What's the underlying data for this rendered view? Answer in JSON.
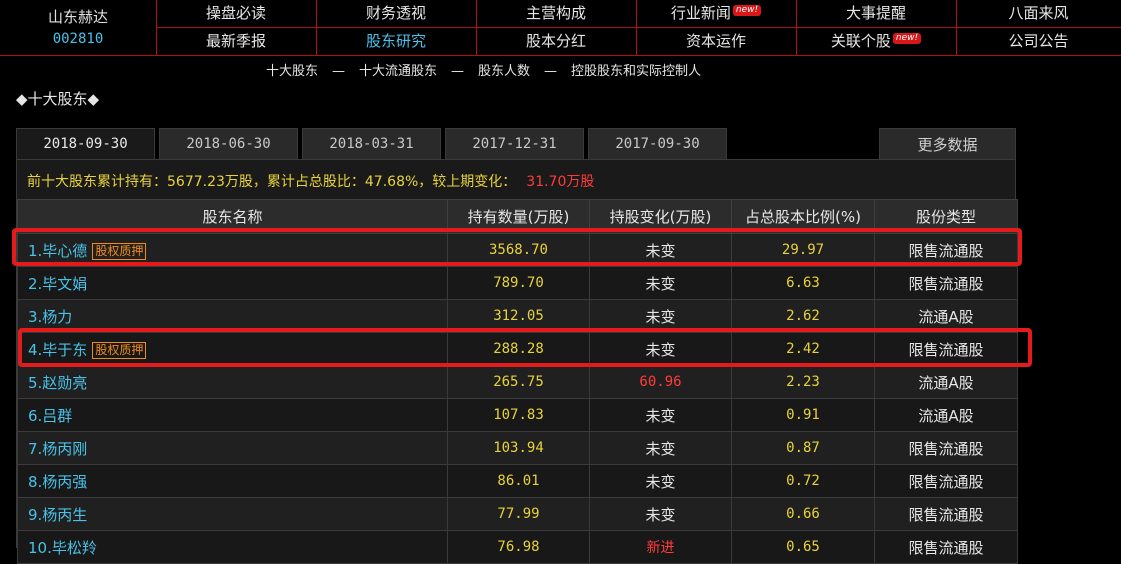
{
  "stock": {
    "name": "山东赫达",
    "code": "002810"
  },
  "nav": {
    "row1": [
      {
        "label": "操盘必读",
        "badge": ""
      },
      {
        "label": "财务透视",
        "badge": ""
      },
      {
        "label": "主营构成",
        "badge": ""
      },
      {
        "label": "行业新闻",
        "badge": "new!"
      },
      {
        "label": "大事提醒",
        "badge": ""
      },
      {
        "label": "八面来风",
        "badge": ""
      }
    ],
    "row2": [
      {
        "label": "最新季报",
        "badge": ""
      },
      {
        "label": "股东研究",
        "badge": "",
        "active": true
      },
      {
        "label": "股本分红",
        "badge": ""
      },
      {
        "label": "资本运作",
        "badge": ""
      },
      {
        "label": "关联个股",
        "badge": "new!"
      },
      {
        "label": "公司公告",
        "badge": ""
      }
    ]
  },
  "subnav": {
    "items": [
      "十大股东",
      "十大流通股东",
      "股东人数",
      "控股股东和实际控制人"
    ],
    "separator": "—"
  },
  "section_title": "◆十大股东◆",
  "tabs": [
    "2018-09-30",
    "2018-06-30",
    "2018-03-31",
    "2017-12-31",
    "2017-09-30"
  ],
  "active_tab": "2018-09-30",
  "more_label": "更多数据",
  "summary": {
    "text": "前十大股东累计持有：5677.23万股，累计占总股比：47.68%，较上期变化：",
    "change": "31.70万股"
  },
  "table": {
    "headers": [
      "股东名称",
      "持有数量(万股)",
      "持股变化(万股)",
      "占总股本比例(%)",
      "股份类型"
    ],
    "rows": [
      {
        "name": "1.毕心德",
        "pledge": "股权质押",
        "qty": "3568.70",
        "change": "未变",
        "ratio": "29.97",
        "type": "限售流通股"
      },
      {
        "name": "2.毕文娟",
        "pledge": "",
        "qty": "789.70",
        "change": "未变",
        "ratio": "6.63",
        "type": "限售流通股"
      },
      {
        "name": "3.杨力",
        "pledge": "",
        "qty": "312.05",
        "change": "未变",
        "ratio": "2.62",
        "type": "流通A股"
      },
      {
        "name": "4.毕于东",
        "pledge": "股权质押",
        "qty": "288.28",
        "change": "未变",
        "ratio": "2.42",
        "type": "限售流通股"
      },
      {
        "name": "5.赵勋亮",
        "pledge": "",
        "qty": "265.75",
        "change": "60.96",
        "ratio": "2.23",
        "type": "流通A股"
      },
      {
        "name": "6.吕群",
        "pledge": "",
        "qty": "107.83",
        "change": "未变",
        "ratio": "0.91",
        "type": "流通A股"
      },
      {
        "name": "7.杨丙刚",
        "pledge": "",
        "qty": "103.94",
        "change": "未变",
        "ratio": "0.87",
        "type": "限售流通股"
      },
      {
        "name": "8.杨丙强",
        "pledge": "",
        "qty": "86.01",
        "change": "未变",
        "ratio": "0.72",
        "type": "限售流通股"
      },
      {
        "name": "9.杨丙生",
        "pledge": "",
        "qty": "77.99",
        "change": "未变",
        "ratio": "0.66",
        "type": "限售流通股"
      },
      {
        "name": "10.毕松羚",
        "pledge": "",
        "qty": "76.98",
        "change": "新进",
        "ratio": "0.65",
        "type": "限售流通股"
      }
    ]
  },
  "colors": {
    "accent_blue": "#49c2e8",
    "yellow": "#e8d23a",
    "red": "#ff3b3b",
    "border_red": "#b01010",
    "pledge_orange": "#f08a1a"
  }
}
